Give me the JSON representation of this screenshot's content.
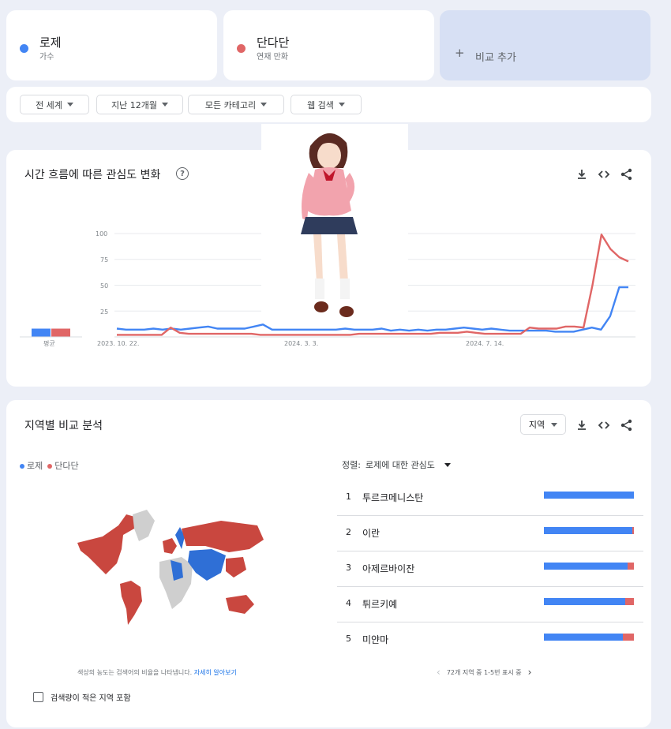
{
  "terms": [
    {
      "name": "로제",
      "sub": "가수",
      "color": "#4285f4"
    },
    {
      "name": "단다단",
      "sub": "연재 만화",
      "color": "#e06666"
    }
  ],
  "add_compare": {
    "plus": "+",
    "label": "비교 추가"
  },
  "filters": [
    {
      "label": "전 세계"
    },
    {
      "label": "지난 12개월"
    },
    {
      "label": "모든 카테고리"
    },
    {
      "label": "웹 검색"
    }
  ],
  "interest_over_time": {
    "title": "시간 흐름에 따른 관심도 변화",
    "help": "?",
    "avg_label": "평균",
    "y_ticks": [
      "100",
      "75",
      "50",
      "25"
    ],
    "x_ticks": [
      "2023. 10. 22.",
      "2024. 3. 3.",
      "2024. 7. 14."
    ]
  },
  "chart_data": {
    "type": "line",
    "title": "시간 흐름에 따른 관심도 변화",
    "xlabel": "",
    "ylabel": "",
    "ylim": [
      0,
      100
    ],
    "x_tick_labels": [
      "2023. 10. 22.",
      "2024. 3. 3.",
      "2024. 7. 14."
    ],
    "averages": [
      {
        "name": "로제",
        "value": 8
      },
      {
        "name": "단다단",
        "value": 8
      }
    ],
    "series": [
      {
        "name": "로제",
        "color": "#4285f4",
        "values": [
          8,
          7,
          7,
          7,
          8,
          7,
          8,
          7,
          8,
          9,
          10,
          8,
          8,
          8,
          8,
          10,
          12,
          7,
          7,
          7,
          7,
          7,
          7,
          7,
          7,
          8,
          7,
          7,
          7,
          8,
          6,
          7,
          6,
          7,
          6,
          7,
          7,
          8,
          9,
          8,
          7,
          8,
          7,
          6,
          6,
          6,
          6,
          6,
          5,
          5,
          5,
          7,
          9,
          7,
          20,
          48,
          48
        ]
      },
      {
        "name": "단다단",
        "color": "#e06666",
        "values": [
          2,
          2,
          2,
          2,
          2,
          2,
          9,
          4,
          3,
          3,
          3,
          3,
          3,
          3,
          3,
          3,
          2,
          2,
          2,
          2,
          2,
          2,
          2,
          2,
          2,
          2,
          2,
          3,
          3,
          3,
          3,
          3,
          3,
          3,
          3,
          3,
          4,
          4,
          4,
          5,
          4,
          3,
          3,
          3,
          3,
          3,
          9,
          8,
          8,
          8,
          10,
          10,
          9,
          50,
          99,
          85,
          77,
          73
        ]
      }
    ]
  },
  "region": {
    "title": "지역별 비교 분석",
    "selector": "지역",
    "legend": [
      "로제",
      "단다단"
    ],
    "sort_label": "정렬:",
    "sort_value": "로제에 대한 관심도",
    "rows": [
      {
        "rank": "1",
        "name": "투르크메니스탄",
        "blue": 100,
        "red": 0
      },
      {
        "rank": "2",
        "name": "이란",
        "blue": 98,
        "red": 2
      },
      {
        "rank": "3",
        "name": "아제르바이잔",
        "blue": 93,
        "red": 7
      },
      {
        "rank": "4",
        "name": "튀르키예",
        "blue": 90,
        "red": 10
      },
      {
        "rank": "5",
        "name": "미얀마",
        "blue": 88,
        "red": 12
      }
    ],
    "map_note": "색상의 농도는 검색어의 비율을 나타냅니다.",
    "map_note_link": "자세히 알아보기",
    "pager": "72개 지역 중 1-5번 표시 중",
    "checkbox_label": "검색량이 적은 지역 포함"
  },
  "colors": {
    "blue": "#4285f4",
    "red": "#e06666",
    "grey": "#cfcfcf"
  }
}
